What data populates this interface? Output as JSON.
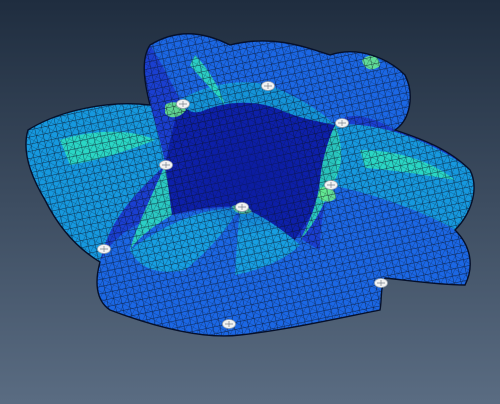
{
  "viewport": {
    "background_top": "#1f2d3f",
    "background_bottom": "#5a6c82"
  },
  "model": {
    "mesh_line_color": "#0a1020",
    "fringe_colors": {
      "lowest": "#0d1fa8",
      "low": "#1a3fd0",
      "mid_low": "#1c6fe8",
      "mid": "#16a8e0",
      "high": "#2ee0c0",
      "peak": "#6cf08a"
    },
    "pin_color": "#f2f2f2",
    "pin_count": 9
  }
}
